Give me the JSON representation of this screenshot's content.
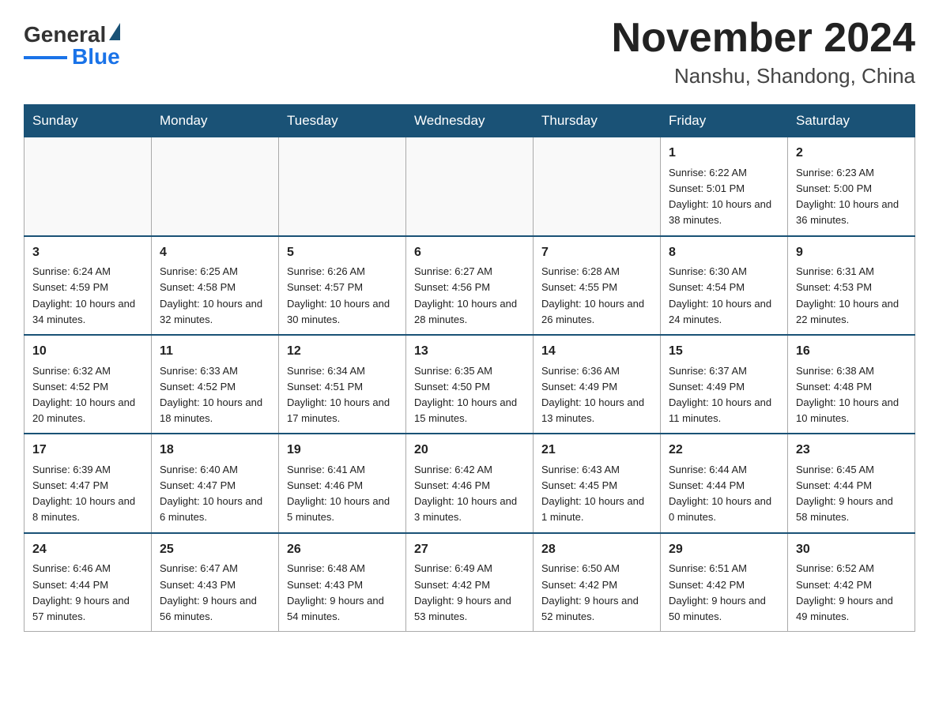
{
  "header": {
    "logo_text_general": "General",
    "logo_text_blue": "Blue",
    "month_title": "November 2024",
    "location": "Nanshu, Shandong, China"
  },
  "weekdays": [
    "Sunday",
    "Monday",
    "Tuesday",
    "Wednesday",
    "Thursday",
    "Friday",
    "Saturday"
  ],
  "weeks": [
    [
      {
        "day": "",
        "info": ""
      },
      {
        "day": "",
        "info": ""
      },
      {
        "day": "",
        "info": ""
      },
      {
        "day": "",
        "info": ""
      },
      {
        "day": "",
        "info": ""
      },
      {
        "day": "1",
        "info": "Sunrise: 6:22 AM\nSunset: 5:01 PM\nDaylight: 10 hours and 38 minutes."
      },
      {
        "day": "2",
        "info": "Sunrise: 6:23 AM\nSunset: 5:00 PM\nDaylight: 10 hours and 36 minutes."
      }
    ],
    [
      {
        "day": "3",
        "info": "Sunrise: 6:24 AM\nSunset: 4:59 PM\nDaylight: 10 hours and 34 minutes."
      },
      {
        "day": "4",
        "info": "Sunrise: 6:25 AM\nSunset: 4:58 PM\nDaylight: 10 hours and 32 minutes."
      },
      {
        "day": "5",
        "info": "Sunrise: 6:26 AM\nSunset: 4:57 PM\nDaylight: 10 hours and 30 minutes."
      },
      {
        "day": "6",
        "info": "Sunrise: 6:27 AM\nSunset: 4:56 PM\nDaylight: 10 hours and 28 minutes."
      },
      {
        "day": "7",
        "info": "Sunrise: 6:28 AM\nSunset: 4:55 PM\nDaylight: 10 hours and 26 minutes."
      },
      {
        "day": "8",
        "info": "Sunrise: 6:30 AM\nSunset: 4:54 PM\nDaylight: 10 hours and 24 minutes."
      },
      {
        "day": "9",
        "info": "Sunrise: 6:31 AM\nSunset: 4:53 PM\nDaylight: 10 hours and 22 minutes."
      }
    ],
    [
      {
        "day": "10",
        "info": "Sunrise: 6:32 AM\nSunset: 4:52 PM\nDaylight: 10 hours and 20 minutes."
      },
      {
        "day": "11",
        "info": "Sunrise: 6:33 AM\nSunset: 4:52 PM\nDaylight: 10 hours and 18 minutes."
      },
      {
        "day": "12",
        "info": "Sunrise: 6:34 AM\nSunset: 4:51 PM\nDaylight: 10 hours and 17 minutes."
      },
      {
        "day": "13",
        "info": "Sunrise: 6:35 AM\nSunset: 4:50 PM\nDaylight: 10 hours and 15 minutes."
      },
      {
        "day": "14",
        "info": "Sunrise: 6:36 AM\nSunset: 4:49 PM\nDaylight: 10 hours and 13 minutes."
      },
      {
        "day": "15",
        "info": "Sunrise: 6:37 AM\nSunset: 4:49 PM\nDaylight: 10 hours and 11 minutes."
      },
      {
        "day": "16",
        "info": "Sunrise: 6:38 AM\nSunset: 4:48 PM\nDaylight: 10 hours and 10 minutes."
      }
    ],
    [
      {
        "day": "17",
        "info": "Sunrise: 6:39 AM\nSunset: 4:47 PM\nDaylight: 10 hours and 8 minutes."
      },
      {
        "day": "18",
        "info": "Sunrise: 6:40 AM\nSunset: 4:47 PM\nDaylight: 10 hours and 6 minutes."
      },
      {
        "day": "19",
        "info": "Sunrise: 6:41 AM\nSunset: 4:46 PM\nDaylight: 10 hours and 5 minutes."
      },
      {
        "day": "20",
        "info": "Sunrise: 6:42 AM\nSunset: 4:46 PM\nDaylight: 10 hours and 3 minutes."
      },
      {
        "day": "21",
        "info": "Sunrise: 6:43 AM\nSunset: 4:45 PM\nDaylight: 10 hours and 1 minute."
      },
      {
        "day": "22",
        "info": "Sunrise: 6:44 AM\nSunset: 4:44 PM\nDaylight: 10 hours and 0 minutes."
      },
      {
        "day": "23",
        "info": "Sunrise: 6:45 AM\nSunset: 4:44 PM\nDaylight: 9 hours and 58 minutes."
      }
    ],
    [
      {
        "day": "24",
        "info": "Sunrise: 6:46 AM\nSunset: 4:44 PM\nDaylight: 9 hours and 57 minutes."
      },
      {
        "day": "25",
        "info": "Sunrise: 6:47 AM\nSunset: 4:43 PM\nDaylight: 9 hours and 56 minutes."
      },
      {
        "day": "26",
        "info": "Sunrise: 6:48 AM\nSunset: 4:43 PM\nDaylight: 9 hours and 54 minutes."
      },
      {
        "day": "27",
        "info": "Sunrise: 6:49 AM\nSunset: 4:42 PM\nDaylight: 9 hours and 53 minutes."
      },
      {
        "day": "28",
        "info": "Sunrise: 6:50 AM\nSunset: 4:42 PM\nDaylight: 9 hours and 52 minutes."
      },
      {
        "day": "29",
        "info": "Sunrise: 6:51 AM\nSunset: 4:42 PM\nDaylight: 9 hours and 50 minutes."
      },
      {
        "day": "30",
        "info": "Sunrise: 6:52 AM\nSunset: 4:42 PM\nDaylight: 9 hours and 49 minutes."
      }
    ]
  ]
}
